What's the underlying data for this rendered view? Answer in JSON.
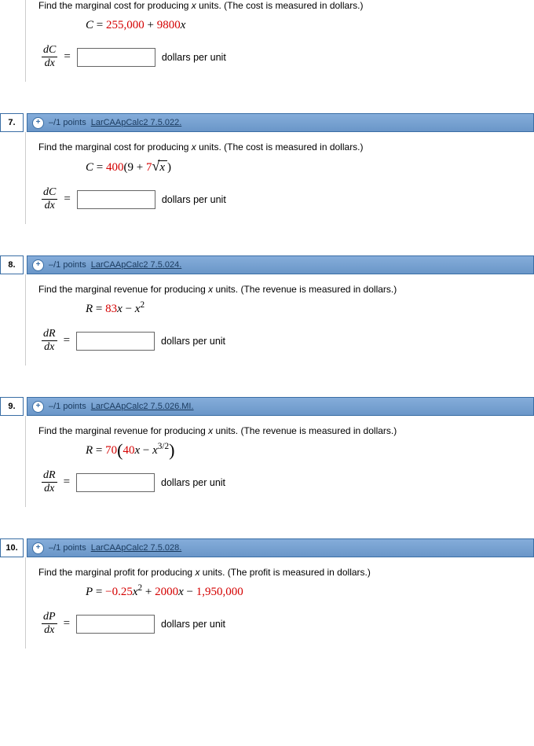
{
  "q6": {
    "prompt_a": "Find the marginal cost for producing ",
    "prompt_var": "x",
    "prompt_b": " units. (The cost is measured in dollars.)",
    "formula_lhs": "C",
    "formula_eq": " = ",
    "formula_a": "255,000",
    "formula_plus": " + ",
    "formula_b": "9800",
    "formula_xvar": "x",
    "deriv_top": "dC",
    "deriv_bot": "dx",
    "unit": "dollars per unit"
  },
  "q7": {
    "num": "7.",
    "points": "–/1 points",
    "ref": "LarCAApCalc2 7.5.022.",
    "prompt_a": "Find the marginal cost for producing ",
    "prompt_var": "x",
    "prompt_b": " units. (The cost is measured in dollars.)",
    "formula_lhs": "C",
    "formula_eq": " = ",
    "formula_a": "400",
    "formula_paren_inner_a": "(9 + ",
    "formula_paren_inner_b": "7",
    "formula_radicand": "x",
    "formula_paren_close": ")",
    "deriv_top": "dC",
    "deriv_bot": "dx",
    "unit": "dollars per unit"
  },
  "q8": {
    "num": "8.",
    "points": "–/1 points",
    "ref": "LarCAApCalc2 7.5.024.",
    "prompt_a": "Find the marginal revenue for producing ",
    "prompt_var": "x",
    "prompt_b": " units. (The revenue is measured in dollars.)",
    "formula_lhs": "R",
    "formula_eq": " = ",
    "formula_a": "83",
    "formula_x1": "x",
    "formula_minus": " − ",
    "formula_x2": "x",
    "formula_exp": "2",
    "deriv_top": "dR",
    "deriv_bot": "dx",
    "unit": "dollars per unit"
  },
  "q9": {
    "num": "9.",
    "points": "–/1 points",
    "ref": "LarCAApCalc2 7.5.026.MI.",
    "prompt_a": "Find the marginal revenue for producing ",
    "prompt_var": "x",
    "prompt_b": " units. (The revenue is measured in dollars.)",
    "formula_lhs": "R",
    "formula_eq": " = ",
    "formula_a": "70",
    "formula_inner_a": "40",
    "formula_x1": "x",
    "formula_minus": " − ",
    "formula_x2": "x",
    "formula_exp": "3/2",
    "deriv_top": "dR",
    "deriv_bot": "dx",
    "unit": "dollars per unit"
  },
  "q10": {
    "num": "10.",
    "points": "–/1 points",
    "ref": "LarCAApCalc2 7.5.028.",
    "prompt_a": "Find the marginal profit for producing ",
    "prompt_var": "x",
    "prompt_b": " units. (The profit is measured in dollars.)",
    "formula_lhs": "P",
    "formula_eq": " = ",
    "formula_a": "−0.25",
    "formula_x1": "x",
    "formula_exp1": "2",
    "formula_plus": " + ",
    "formula_b": "2000",
    "formula_x2": "x",
    "formula_minus": " − ",
    "formula_c": "1,950,000",
    "deriv_top": "dP",
    "deriv_bot": "dx",
    "unit": "dollars per unit"
  }
}
